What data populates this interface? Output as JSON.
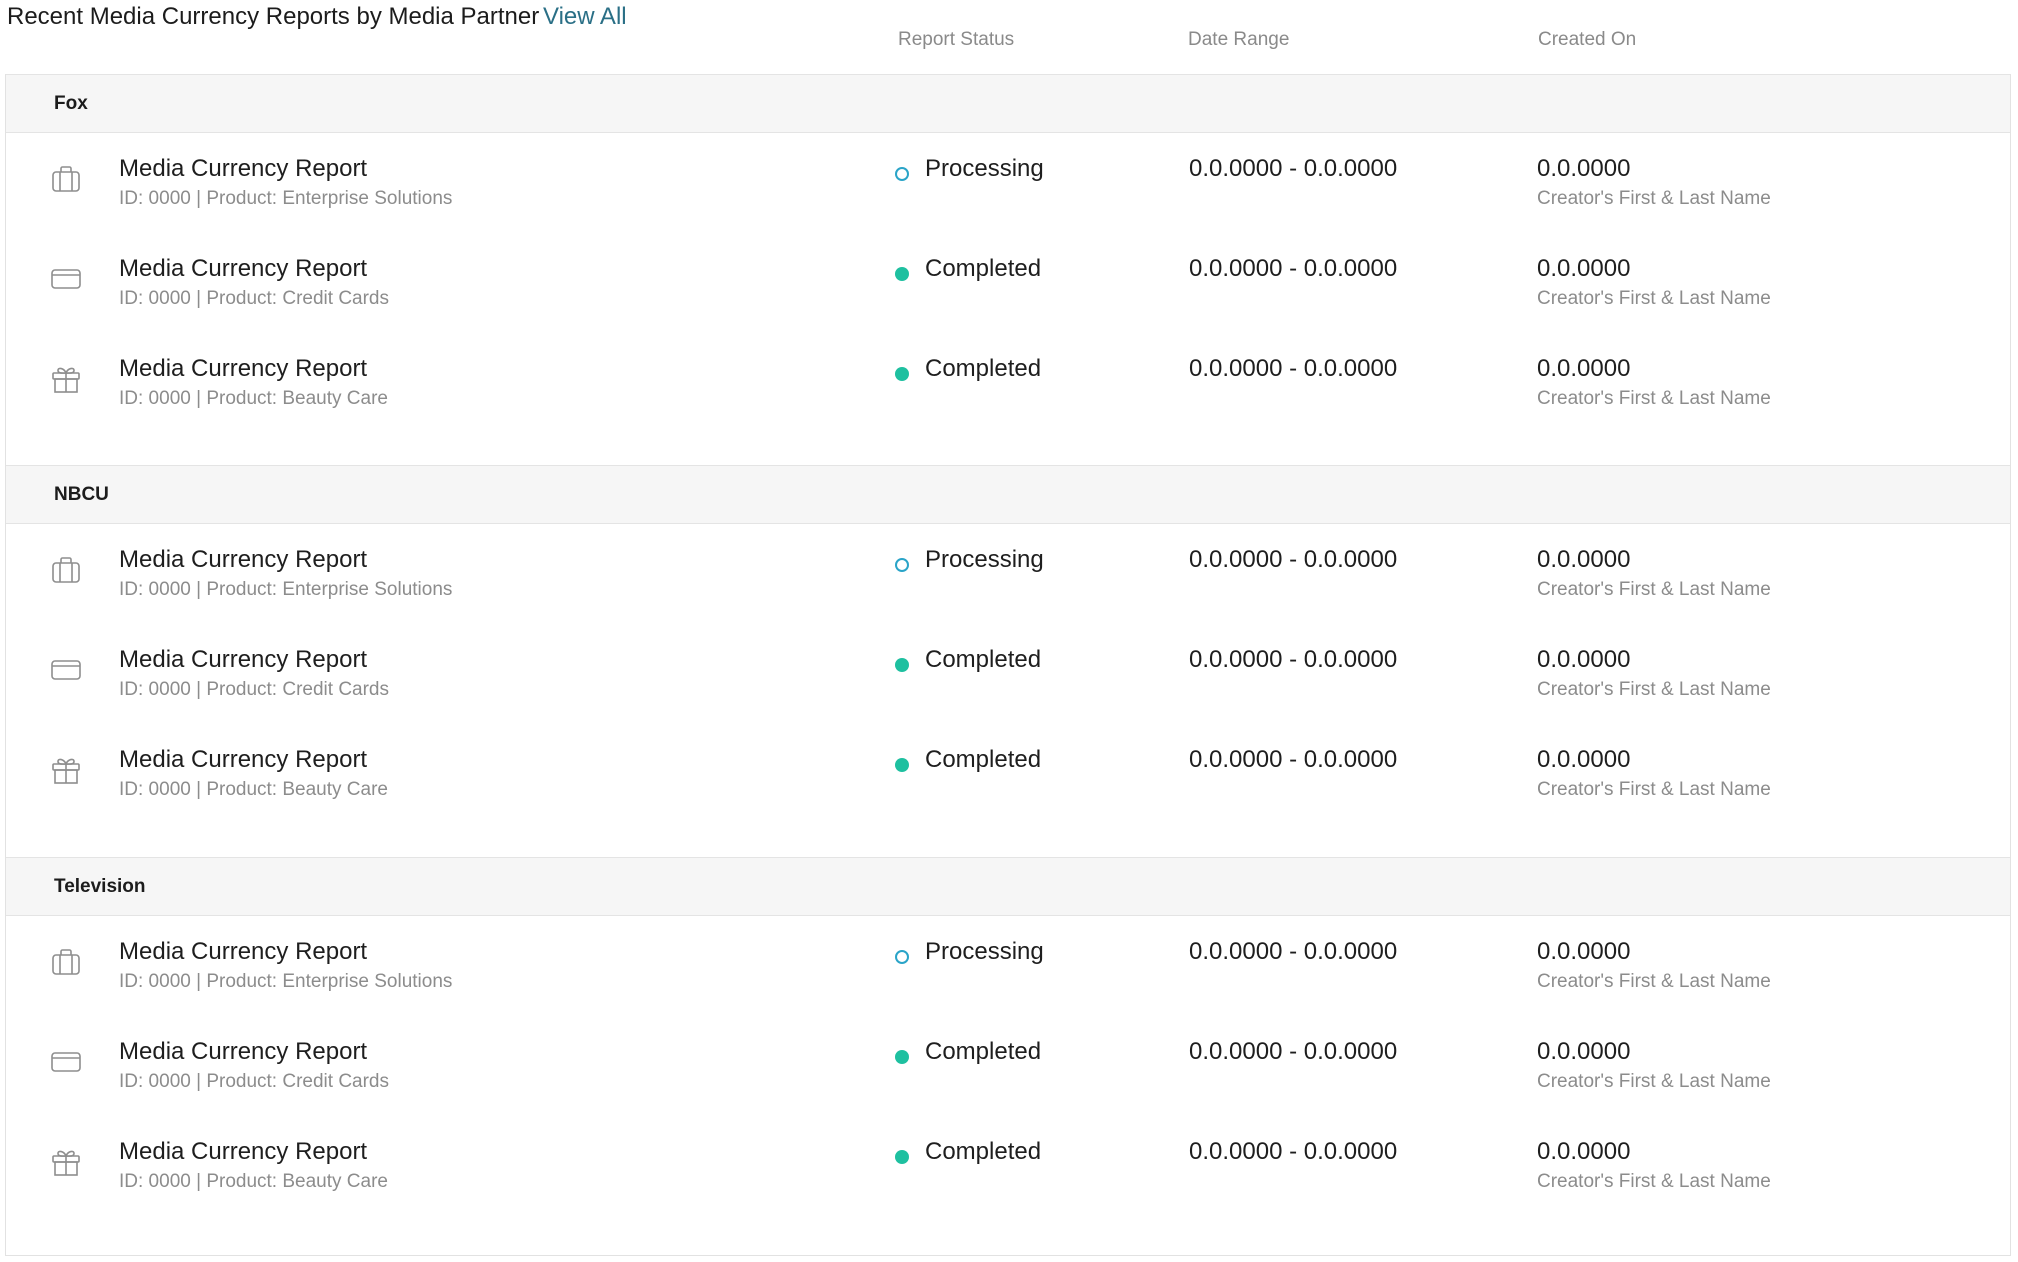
{
  "header": {
    "title": "Recent Media Currency Reports by Media Partner",
    "view_all": "View All",
    "columns": {
      "status": "Report Status",
      "date_range": "Date Range",
      "created_on": "Created On"
    }
  },
  "colors": {
    "completed": "#1ec0a0",
    "processing": "#2aa4c8",
    "link": "#2a6f86"
  },
  "sections": [
    {
      "name": "Fox",
      "rows": [
        {
          "icon": "briefcase-icon",
          "name": "Media Currency Report",
          "sub": "ID: 0000 | Product: Enterprise Solutions",
          "status": "Processing",
          "status_type": "processing",
          "date_range": "0.0.0000 - 0.0.0000",
          "created": "0.0.0000",
          "creator": "Creator's First & Last Name"
        },
        {
          "icon": "credit-card-icon",
          "name": "Media Currency Report",
          "sub": "ID: 0000 | Product: Credit Cards",
          "status": "Completed",
          "status_type": "completed",
          "date_range": "0.0.0000 - 0.0.0000",
          "created": "0.0.0000",
          "creator": "Creator's First & Last Name"
        },
        {
          "icon": "gift-icon",
          "name": "Media Currency Report",
          "sub": "ID: 0000 | Product: Beauty Care",
          "status": "Completed",
          "status_type": "completed",
          "date_range": "0.0.0000 - 0.0.0000",
          "created": "0.0.0000",
          "creator": "Creator's First & Last Name"
        }
      ]
    },
    {
      "name": "NBCU",
      "rows": [
        {
          "icon": "briefcase-icon",
          "name": "Media Currency Report",
          "sub": "ID: 0000 | Product: Enterprise Solutions",
          "status": "Processing",
          "status_type": "processing",
          "date_range": "0.0.0000 - 0.0.0000",
          "created": "0.0.0000",
          "creator": "Creator's First & Last Name"
        },
        {
          "icon": "credit-card-icon",
          "name": "Media Currency Report",
          "sub": "ID: 0000 | Product: Credit Cards",
          "status": "Completed",
          "status_type": "completed",
          "date_range": "0.0.0000 - 0.0.0000",
          "created": "0.0.0000",
          "creator": "Creator's First & Last Name"
        },
        {
          "icon": "gift-icon",
          "name": "Media Currency Report",
          "sub": "ID: 0000 | Product: Beauty Care",
          "status": "Completed",
          "status_type": "completed",
          "date_range": "0.0.0000 - 0.0.0000",
          "created": "0.0.0000",
          "creator": "Creator's First & Last Name"
        }
      ]
    },
    {
      "name": "Television",
      "rows": [
        {
          "icon": "briefcase-icon",
          "name": "Media Currency Report",
          "sub": "ID: 0000 | Product: Enterprise Solutions",
          "status": "Processing",
          "status_type": "processing",
          "date_range": "0.0.0000 - 0.0.0000",
          "created": "0.0.0000",
          "creator": "Creator's First & Last Name"
        },
        {
          "icon": "credit-card-icon",
          "name": "Media Currency Report",
          "sub": "ID: 0000 | Product: Credit Cards",
          "status": "Completed",
          "status_type": "completed",
          "date_range": "0.0.0000 - 0.0.0000",
          "created": "0.0.0000",
          "creator": "Creator's First & Last Name"
        },
        {
          "icon": "gift-icon",
          "name": "Media Currency Report",
          "sub": "ID: 0000 | Product: Beauty Care",
          "status": "Completed",
          "status_type": "completed",
          "date_range": "0.0.0000 - 0.0.0000",
          "created": "0.0.0000",
          "creator": "Creator's First & Last Name"
        }
      ]
    }
  ]
}
